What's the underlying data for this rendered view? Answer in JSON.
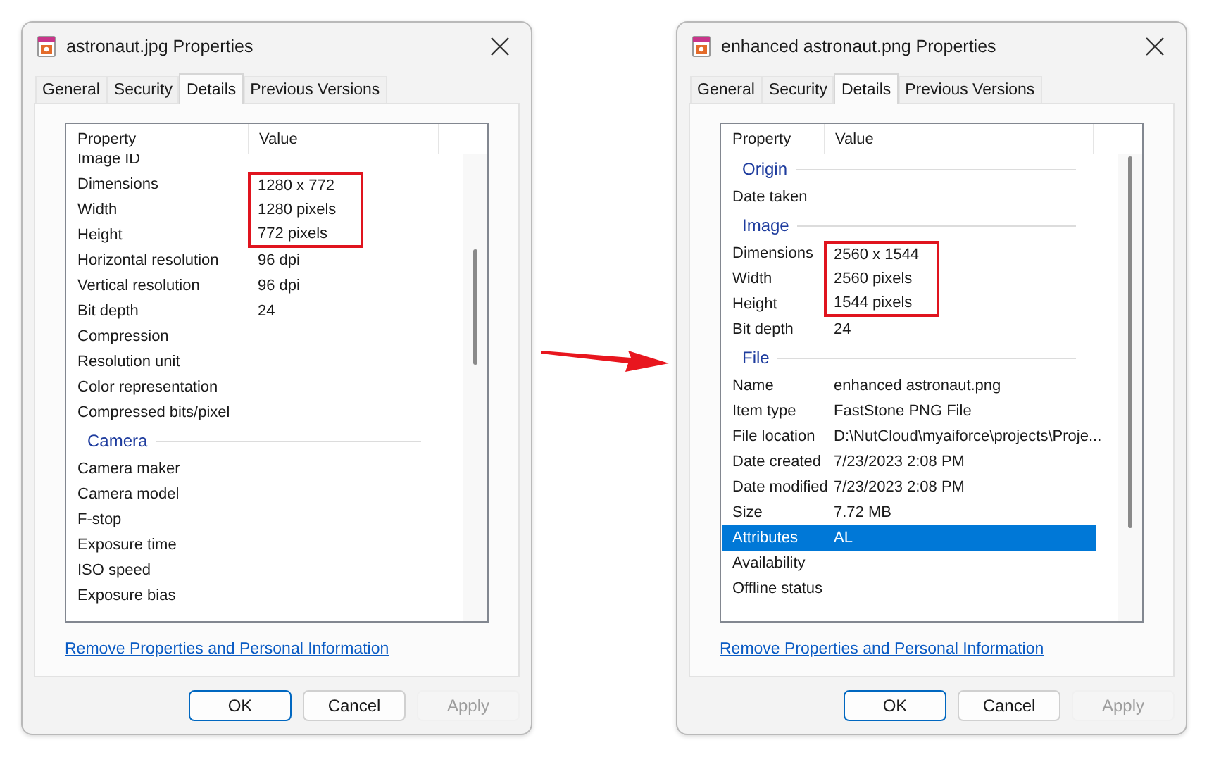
{
  "dialogs": [
    {
      "title": "astronaut.jpg Properties",
      "tabs": [
        {
          "label": "General",
          "selected": false
        },
        {
          "label": "Security",
          "selected": false
        },
        {
          "label": "Details",
          "selected": true
        },
        {
          "label": "Previous Versions",
          "selected": false
        }
      ],
      "columns": [
        "Property",
        "Value"
      ],
      "rows": [
        {
          "kind": "item",
          "property": "Image ID",
          "highlighted": false,
          "selected": false
        },
        {
          "kind": "item",
          "property": "Dimensions",
          "value": "1280 x 772",
          "highlighted": true,
          "selected": false
        },
        {
          "kind": "item",
          "property": "Width",
          "value": "1280 pixels",
          "highlighted": true,
          "selected": false
        },
        {
          "kind": "item",
          "property": "Height",
          "value": "772 pixels",
          "highlighted": true,
          "selected": false
        },
        {
          "kind": "item",
          "property": "Horizontal resolution",
          "value": "96 dpi",
          "highlighted": false,
          "selected": false
        },
        {
          "kind": "item",
          "property": "Vertical resolution",
          "value": "96 dpi",
          "highlighted": false,
          "selected": false
        },
        {
          "kind": "item",
          "property": "Bit depth",
          "value": "24",
          "highlighted": false,
          "selected": false
        },
        {
          "kind": "item",
          "property": "Compression",
          "highlighted": false,
          "selected": false
        },
        {
          "kind": "item",
          "property": "Resolution unit",
          "highlighted": false,
          "selected": false
        },
        {
          "kind": "item",
          "property": "Color representation",
          "highlighted": false,
          "selected": false
        },
        {
          "kind": "item",
          "property": "Compressed bits/pixel",
          "highlighted": false,
          "selected": false
        },
        {
          "kind": "group",
          "label": "Camera"
        },
        {
          "kind": "item",
          "property": "Camera maker",
          "highlighted": false,
          "selected": false
        },
        {
          "kind": "item",
          "property": "Camera model",
          "highlighted": false,
          "selected": false
        },
        {
          "kind": "item",
          "property": "F-stop",
          "highlighted": false,
          "selected": false
        },
        {
          "kind": "item",
          "property": "Exposure time",
          "highlighted": false,
          "selected": false
        },
        {
          "kind": "item",
          "property": "ISO speed",
          "highlighted": false,
          "selected": false
        },
        {
          "kind": "item",
          "property": "Exposure bias",
          "highlighted": false,
          "selected": false
        }
      ],
      "link": "Remove Properties and Personal Information",
      "buttons": [
        {
          "label": "OK",
          "default": true,
          "disabled": false
        },
        {
          "label": "Cancel",
          "default": false,
          "disabled": false
        },
        {
          "label": "Apply",
          "default": false,
          "disabled": true
        }
      ]
    },
    {
      "title": "enhanced astronaut.png Properties",
      "tabs": [
        {
          "label": "General",
          "selected": false
        },
        {
          "label": "Security",
          "selected": false
        },
        {
          "label": "Details",
          "selected": true
        },
        {
          "label": "Previous Versions",
          "selected": false
        }
      ],
      "columns": [
        "Property",
        "Value"
      ],
      "rows": [
        {
          "kind": "group",
          "label": "Origin"
        },
        {
          "kind": "item",
          "property": "Date taken",
          "highlighted": false,
          "selected": false
        },
        {
          "kind": "group",
          "label": "Image"
        },
        {
          "kind": "item",
          "property": "Dimensions",
          "value": "2560 x 1544",
          "highlighted": true,
          "selected": false
        },
        {
          "kind": "item",
          "property": "Width",
          "value": "2560 pixels",
          "highlighted": true,
          "selected": false
        },
        {
          "kind": "item",
          "property": "Height",
          "value": "1544 pixels",
          "highlighted": true,
          "selected": false
        },
        {
          "kind": "item",
          "property": "Bit depth",
          "value": "24",
          "highlighted": false,
          "selected": false
        },
        {
          "kind": "group",
          "label": "File"
        },
        {
          "kind": "item",
          "property": "Name",
          "value": "enhanced astronaut.png",
          "highlighted": false,
          "selected": false
        },
        {
          "kind": "item",
          "property": "Item type",
          "value": "FastStone PNG File",
          "highlighted": false,
          "selected": false
        },
        {
          "kind": "item",
          "property": "File location",
          "value": "D:\\NutCloud\\myaiforce\\projects\\Proje...",
          "highlighted": false,
          "selected": false
        },
        {
          "kind": "item",
          "property": "Date created",
          "value": "7/23/2023 2:08 PM",
          "highlighted": false,
          "selected": false
        },
        {
          "kind": "item",
          "property": "Date modified",
          "value": "7/23/2023 2:08 PM",
          "highlighted": false,
          "selected": false
        },
        {
          "kind": "item",
          "property": "Size",
          "value": "7.72 MB",
          "highlighted": false,
          "selected": false
        },
        {
          "kind": "item",
          "property": "Attributes",
          "value": "AL",
          "highlighted": false,
          "selected": true
        },
        {
          "kind": "item",
          "property": "Availability",
          "highlighted": false,
          "selected": false
        },
        {
          "kind": "item",
          "property": "Offline status",
          "highlighted": false,
          "selected": false
        }
      ],
      "link": "Remove Properties and Personal Information",
      "buttons": [
        {
          "label": "OK",
          "default": true,
          "disabled": false
        },
        {
          "label": "Cancel",
          "default": false,
          "disabled": false
        },
        {
          "label": "Apply",
          "default": false,
          "disabled": true
        }
      ]
    }
  ]
}
